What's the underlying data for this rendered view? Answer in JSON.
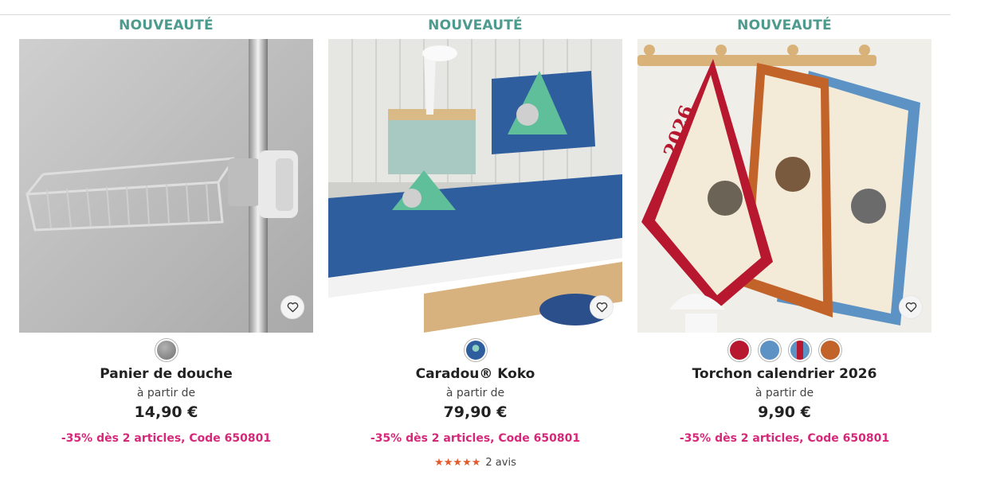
{
  "products": [
    {
      "badge": "NOUVEAUTÉ",
      "name": "Panier de douche",
      "from_label": "à partir de",
      "price": "14,90 €",
      "promo": "-35% dès 2 articles, Code 650801",
      "swatches": [
        {
          "color": "#8a8a8a",
          "name": "gris"
        }
      ]
    },
    {
      "badge": "NOUVEAUTÉ",
      "name": "Caradou® Koko",
      "from_label": "à partir de",
      "price": "79,90 €",
      "promo": "-35% dès 2 articles, Code 650801",
      "swatches": [
        {
          "color": "#2f4f7a",
          "name": "bleu-koko"
        }
      ],
      "rating": {
        "stars": 5,
        "stars_text": "★★★★★",
        "reviews": "2 avis"
      }
    },
    {
      "badge": "NOUVEAUTÉ",
      "name": "Torchon calendrier 2026",
      "from_label": "à partir de",
      "price": "9,90 €",
      "promo": "-35% dès 2 articles, Code 650801",
      "swatches": [
        {
          "color": "#b7182f",
          "name": "rouge"
        },
        {
          "color": "#5d93c4",
          "name": "bleu"
        },
        {
          "color": "#b7182f",
          "color2": "#5d93c4",
          "name": "multicolore"
        },
        {
          "color": "#c2632a",
          "name": "orange"
        }
      ]
    }
  ],
  "tea_towel_print": "2026",
  "colors": {
    "badge": "#4d9b8e",
    "promo": "#d6287a",
    "stars": "#e55a2b"
  },
  "icons": {
    "favorite": "heart-outline-icon",
    "rating_star": "star-icon"
  }
}
